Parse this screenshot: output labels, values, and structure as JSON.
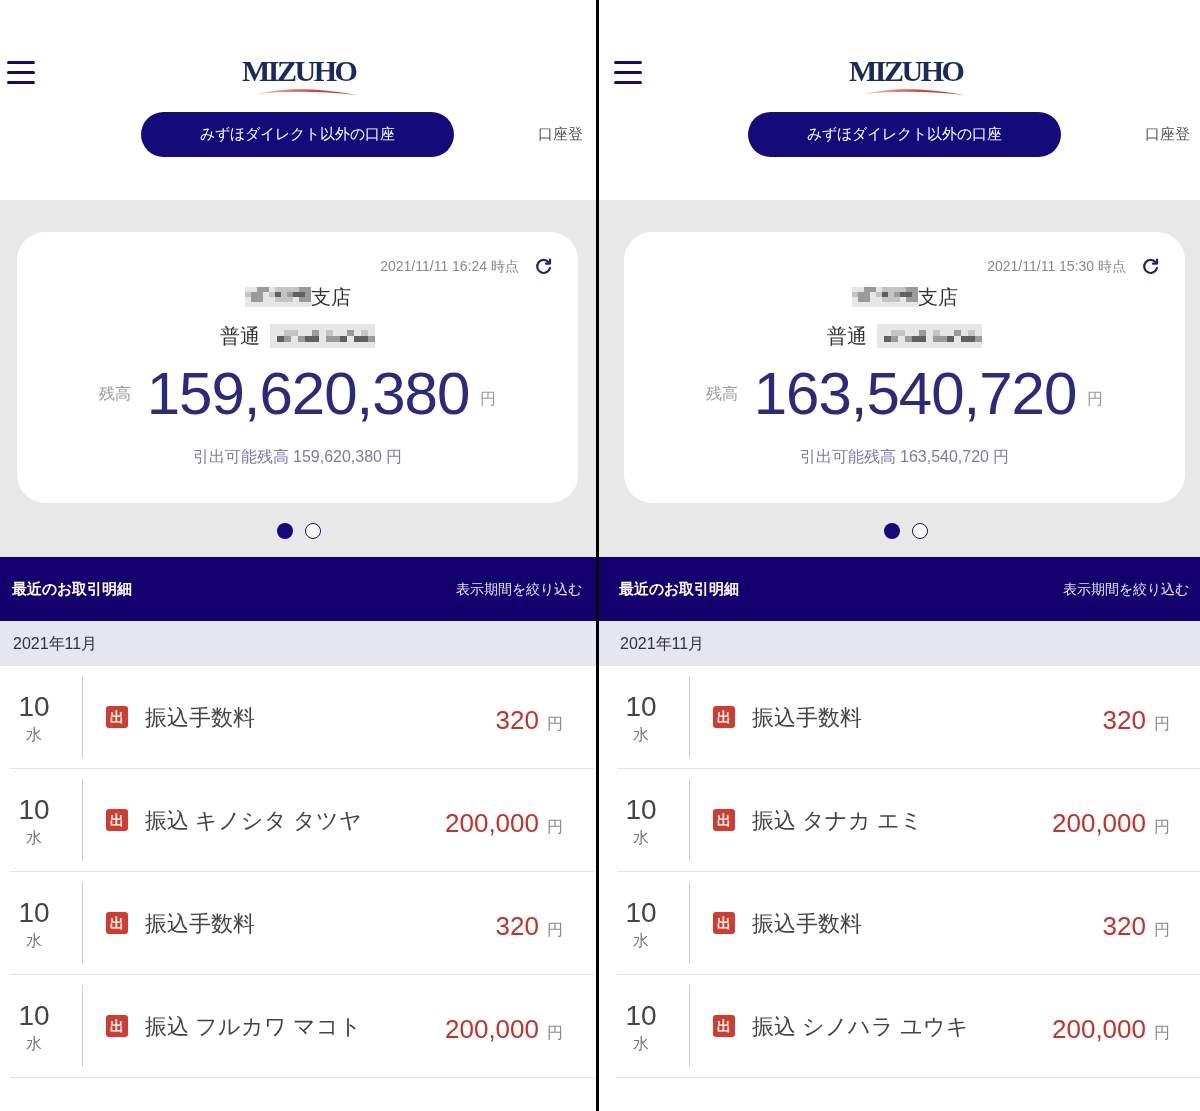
{
  "screens": [
    {
      "logo": "MIZUHO",
      "tabs": [
        {
          "label": "みずほダイレクト以外の口座",
          "selected": true
        },
        {
          "label": "口座登",
          "selected": false
        }
      ],
      "account_card": {
        "timestamp": "2021/11/11 16:24 時点",
        "branch": "支店",
        "account_type": "普通",
        "balance_label": "残高",
        "balance": "159,620,380",
        "currency": "円",
        "available_balance": "引出可能残高 159,620,380 円"
      },
      "pager": [
        {
          "selected": true
        },
        {
          "selected": false
        }
      ],
      "transactions": {
        "title": "最近のお取引明細",
        "filter_link": "表示期間を絞り込む",
        "month": "2021年11月",
        "rows": [
          {
            "day": "10",
            "weekday": "水",
            "badge": "出",
            "description": "振込手数料",
            "amount": "320",
            "currency": "円"
          },
          {
            "day": "10",
            "weekday": "水",
            "badge": "出",
            "description": "振込 キノシタ タツヤ",
            "amount": "200,000",
            "currency": "円"
          },
          {
            "day": "10",
            "weekday": "水",
            "badge": "出",
            "description": "振込手数料",
            "amount": "320",
            "currency": "円"
          },
          {
            "day": "10",
            "weekday": "水",
            "badge": "出",
            "description": "振込 フルカワ マコト",
            "amount": "200,000",
            "currency": "円"
          }
        ]
      }
    },
    {
      "logo": "MIZUHO",
      "tabs": [
        {
          "label": "みずほダイレクト以外の口座",
          "selected": true
        },
        {
          "label": "口座登",
          "selected": false
        }
      ],
      "account_card": {
        "timestamp": "2021/11/11 15:30 時点",
        "branch": "支店",
        "account_type": "普通",
        "balance_label": "残高",
        "balance": "163,540,720",
        "currency": "円",
        "available_balance": "引出可能残高 163,540,720 円"
      },
      "pager": [
        {
          "selected": true
        },
        {
          "selected": false
        }
      ],
      "transactions": {
        "title": "最近のお取引明細",
        "filter_link": "表示期間を絞り込む",
        "month": "2021年11月",
        "rows": [
          {
            "day": "10",
            "weekday": "水",
            "badge": "出",
            "description": "振込手数料",
            "amount": "320",
            "currency": "円"
          },
          {
            "day": "10",
            "weekday": "水",
            "badge": "出",
            "description": "振込 タナカ エミ",
            "amount": "200,000",
            "currency": "円"
          },
          {
            "day": "10",
            "weekday": "水",
            "badge": "出",
            "description": "振込手数料",
            "amount": "320",
            "currency": "円"
          },
          {
            "day": "10",
            "weekday": "水",
            "badge": "出",
            "description": "振込 シノハラ ユウキ",
            "amount": "200,000",
            "currency": "円"
          }
        ]
      }
    }
  ]
}
